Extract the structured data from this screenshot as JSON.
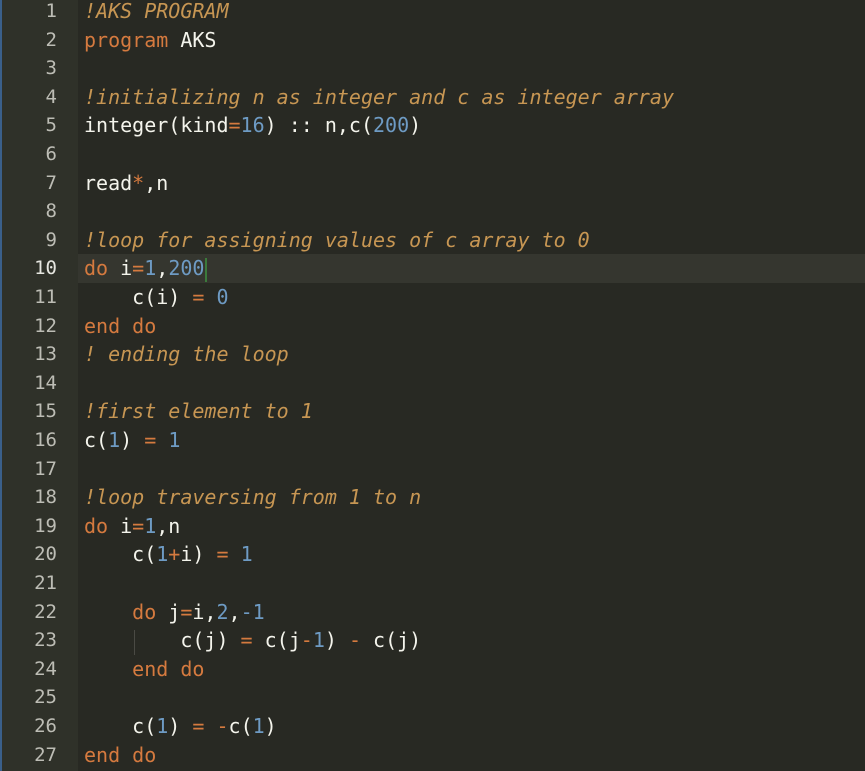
{
  "editor": {
    "current_line": 10,
    "lines": [
      {
        "n": "1",
        "tokens": [
          {
            "t": "!AKS PROGRAM",
            "c": "comment"
          }
        ]
      },
      {
        "n": "2",
        "tokens": [
          {
            "t": "program ",
            "c": "kw"
          },
          {
            "t": "AKS",
            "c": "id"
          }
        ]
      },
      {
        "n": "3",
        "tokens": []
      },
      {
        "n": "4",
        "tokens": [
          {
            "t": "!initializing n as integer and c as integer array",
            "c": "comment"
          }
        ]
      },
      {
        "n": "5",
        "tokens": [
          {
            "t": "integer(kind",
            "c": "id"
          },
          {
            "t": "=",
            "c": "op"
          },
          {
            "t": "16",
            "c": "num"
          },
          {
            "t": ") :: n,c(",
            "c": "id"
          },
          {
            "t": "200",
            "c": "num"
          },
          {
            "t": ")",
            "c": "id"
          }
        ]
      },
      {
        "n": "6",
        "tokens": []
      },
      {
        "n": "7",
        "tokens": [
          {
            "t": "read",
            "c": "id"
          },
          {
            "t": "*",
            "c": "op"
          },
          {
            "t": ",n",
            "c": "id"
          }
        ]
      },
      {
        "n": "8",
        "tokens": []
      },
      {
        "n": "9",
        "tokens": [
          {
            "t": "!loop for assigning values of c array to 0",
            "c": "comment"
          }
        ]
      },
      {
        "n": "10",
        "tokens": [
          {
            "t": "do ",
            "c": "kw"
          },
          {
            "t": "i",
            "c": "id"
          },
          {
            "t": "=",
            "c": "op"
          },
          {
            "t": "1",
            "c": "num"
          },
          {
            "t": ",",
            "c": "id"
          },
          {
            "t": "200",
            "c": "num"
          }
        ]
      },
      {
        "n": "11",
        "tokens": [
          {
            "t": "    c(i) ",
            "c": "id"
          },
          {
            "t": "=",
            "c": "op"
          },
          {
            "t": " ",
            "c": "id"
          },
          {
            "t": "0",
            "c": "num"
          }
        ]
      },
      {
        "n": "12",
        "tokens": [
          {
            "t": "end do",
            "c": "kw"
          }
        ]
      },
      {
        "n": "13",
        "tokens": [
          {
            "t": "! ending the loop",
            "c": "comment"
          }
        ]
      },
      {
        "n": "14",
        "tokens": []
      },
      {
        "n": "15",
        "tokens": [
          {
            "t": "!first element to 1",
            "c": "comment"
          }
        ]
      },
      {
        "n": "16",
        "tokens": [
          {
            "t": "c(",
            "c": "id"
          },
          {
            "t": "1",
            "c": "num"
          },
          {
            "t": ") ",
            "c": "id"
          },
          {
            "t": "=",
            "c": "op"
          },
          {
            "t": " ",
            "c": "id"
          },
          {
            "t": "1",
            "c": "num"
          }
        ]
      },
      {
        "n": "17",
        "tokens": []
      },
      {
        "n": "18",
        "tokens": [
          {
            "t": "!loop traversing from 1 to n",
            "c": "comment"
          }
        ]
      },
      {
        "n": "19",
        "tokens": [
          {
            "t": "do ",
            "c": "kw"
          },
          {
            "t": "i",
            "c": "id"
          },
          {
            "t": "=",
            "c": "op"
          },
          {
            "t": "1",
            "c": "num"
          },
          {
            "t": ",n",
            "c": "id"
          }
        ]
      },
      {
        "n": "20",
        "tokens": [
          {
            "t": "    c(",
            "c": "id"
          },
          {
            "t": "1",
            "c": "num"
          },
          {
            "t": "+",
            "c": "op"
          },
          {
            "t": "i) ",
            "c": "id"
          },
          {
            "t": "=",
            "c": "op"
          },
          {
            "t": " ",
            "c": "id"
          },
          {
            "t": "1",
            "c": "num"
          }
        ]
      },
      {
        "n": "21",
        "tokens": []
      },
      {
        "n": "22",
        "tokens": [
          {
            "t": "    do ",
            "c": "kw"
          },
          {
            "t": "j",
            "c": "id"
          },
          {
            "t": "=",
            "c": "op"
          },
          {
            "t": "i,",
            "c": "id"
          },
          {
            "t": "2",
            "c": "num"
          },
          {
            "t": ",",
            "c": "id"
          },
          {
            "t": "-1",
            "c": "num"
          }
        ]
      },
      {
        "n": "23",
        "tokens": [
          {
            "t": "        c(j) ",
            "c": "id"
          },
          {
            "t": "=",
            "c": "op"
          },
          {
            "t": " c(j",
            "c": "id"
          },
          {
            "t": "-",
            "c": "op"
          },
          {
            "t": "1",
            "c": "num"
          },
          {
            "t": ") ",
            "c": "id"
          },
          {
            "t": "-",
            "c": "op"
          },
          {
            "t": " c(j)",
            "c": "id"
          }
        ]
      },
      {
        "n": "24",
        "tokens": [
          {
            "t": "    end do",
            "c": "kw"
          }
        ]
      },
      {
        "n": "25",
        "tokens": []
      },
      {
        "n": "26",
        "tokens": [
          {
            "t": "    c(",
            "c": "id"
          },
          {
            "t": "1",
            "c": "num"
          },
          {
            "t": ") ",
            "c": "id"
          },
          {
            "t": "=",
            "c": "op"
          },
          {
            "t": " ",
            "c": "id"
          },
          {
            "t": "-",
            "c": "op"
          },
          {
            "t": "c(",
            "c": "id"
          },
          {
            "t": "1",
            "c": "num"
          },
          {
            "t": ")",
            "c": "id"
          }
        ]
      },
      {
        "n": "27",
        "tokens": [
          {
            "t": "end do",
            "c": "kw"
          }
        ]
      }
    ]
  }
}
